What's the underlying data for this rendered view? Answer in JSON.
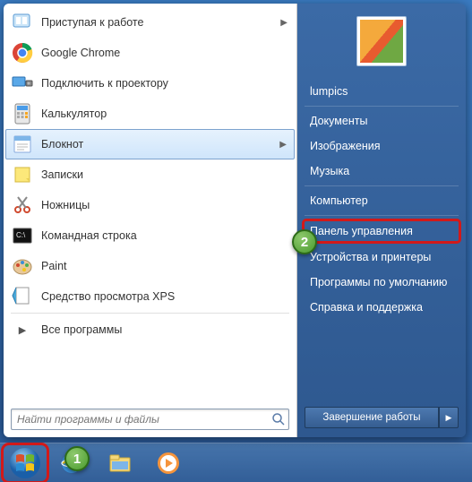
{
  "left": {
    "items": [
      {
        "label": "Приступая к работе",
        "has_arrow": true
      },
      {
        "label": "Google Chrome"
      },
      {
        "label": "Подключить к проектору"
      },
      {
        "label": "Калькулятор"
      },
      {
        "label": "Блокнот",
        "has_arrow": true,
        "hover": true
      },
      {
        "label": "Записки"
      },
      {
        "label": "Ножницы"
      },
      {
        "label": "Командная строка"
      },
      {
        "label": "Paint"
      },
      {
        "label": "Средство просмотра XPS"
      }
    ],
    "all_programs": "Все программы",
    "search_placeholder": "Найти программы и файлы"
  },
  "right": {
    "user": "lumpics",
    "groups": [
      [
        "Документы",
        "Изображения",
        "Музыка"
      ],
      [
        "Компьютер"
      ],
      [
        "Панель управления",
        "Устройства и принтеры",
        "Программы по умолчанию",
        "Справка и поддержка"
      ]
    ],
    "highlight_index": [
      2,
      0
    ],
    "shutdown": "Завершение работы"
  },
  "badges": {
    "one": "1",
    "two": "2"
  }
}
